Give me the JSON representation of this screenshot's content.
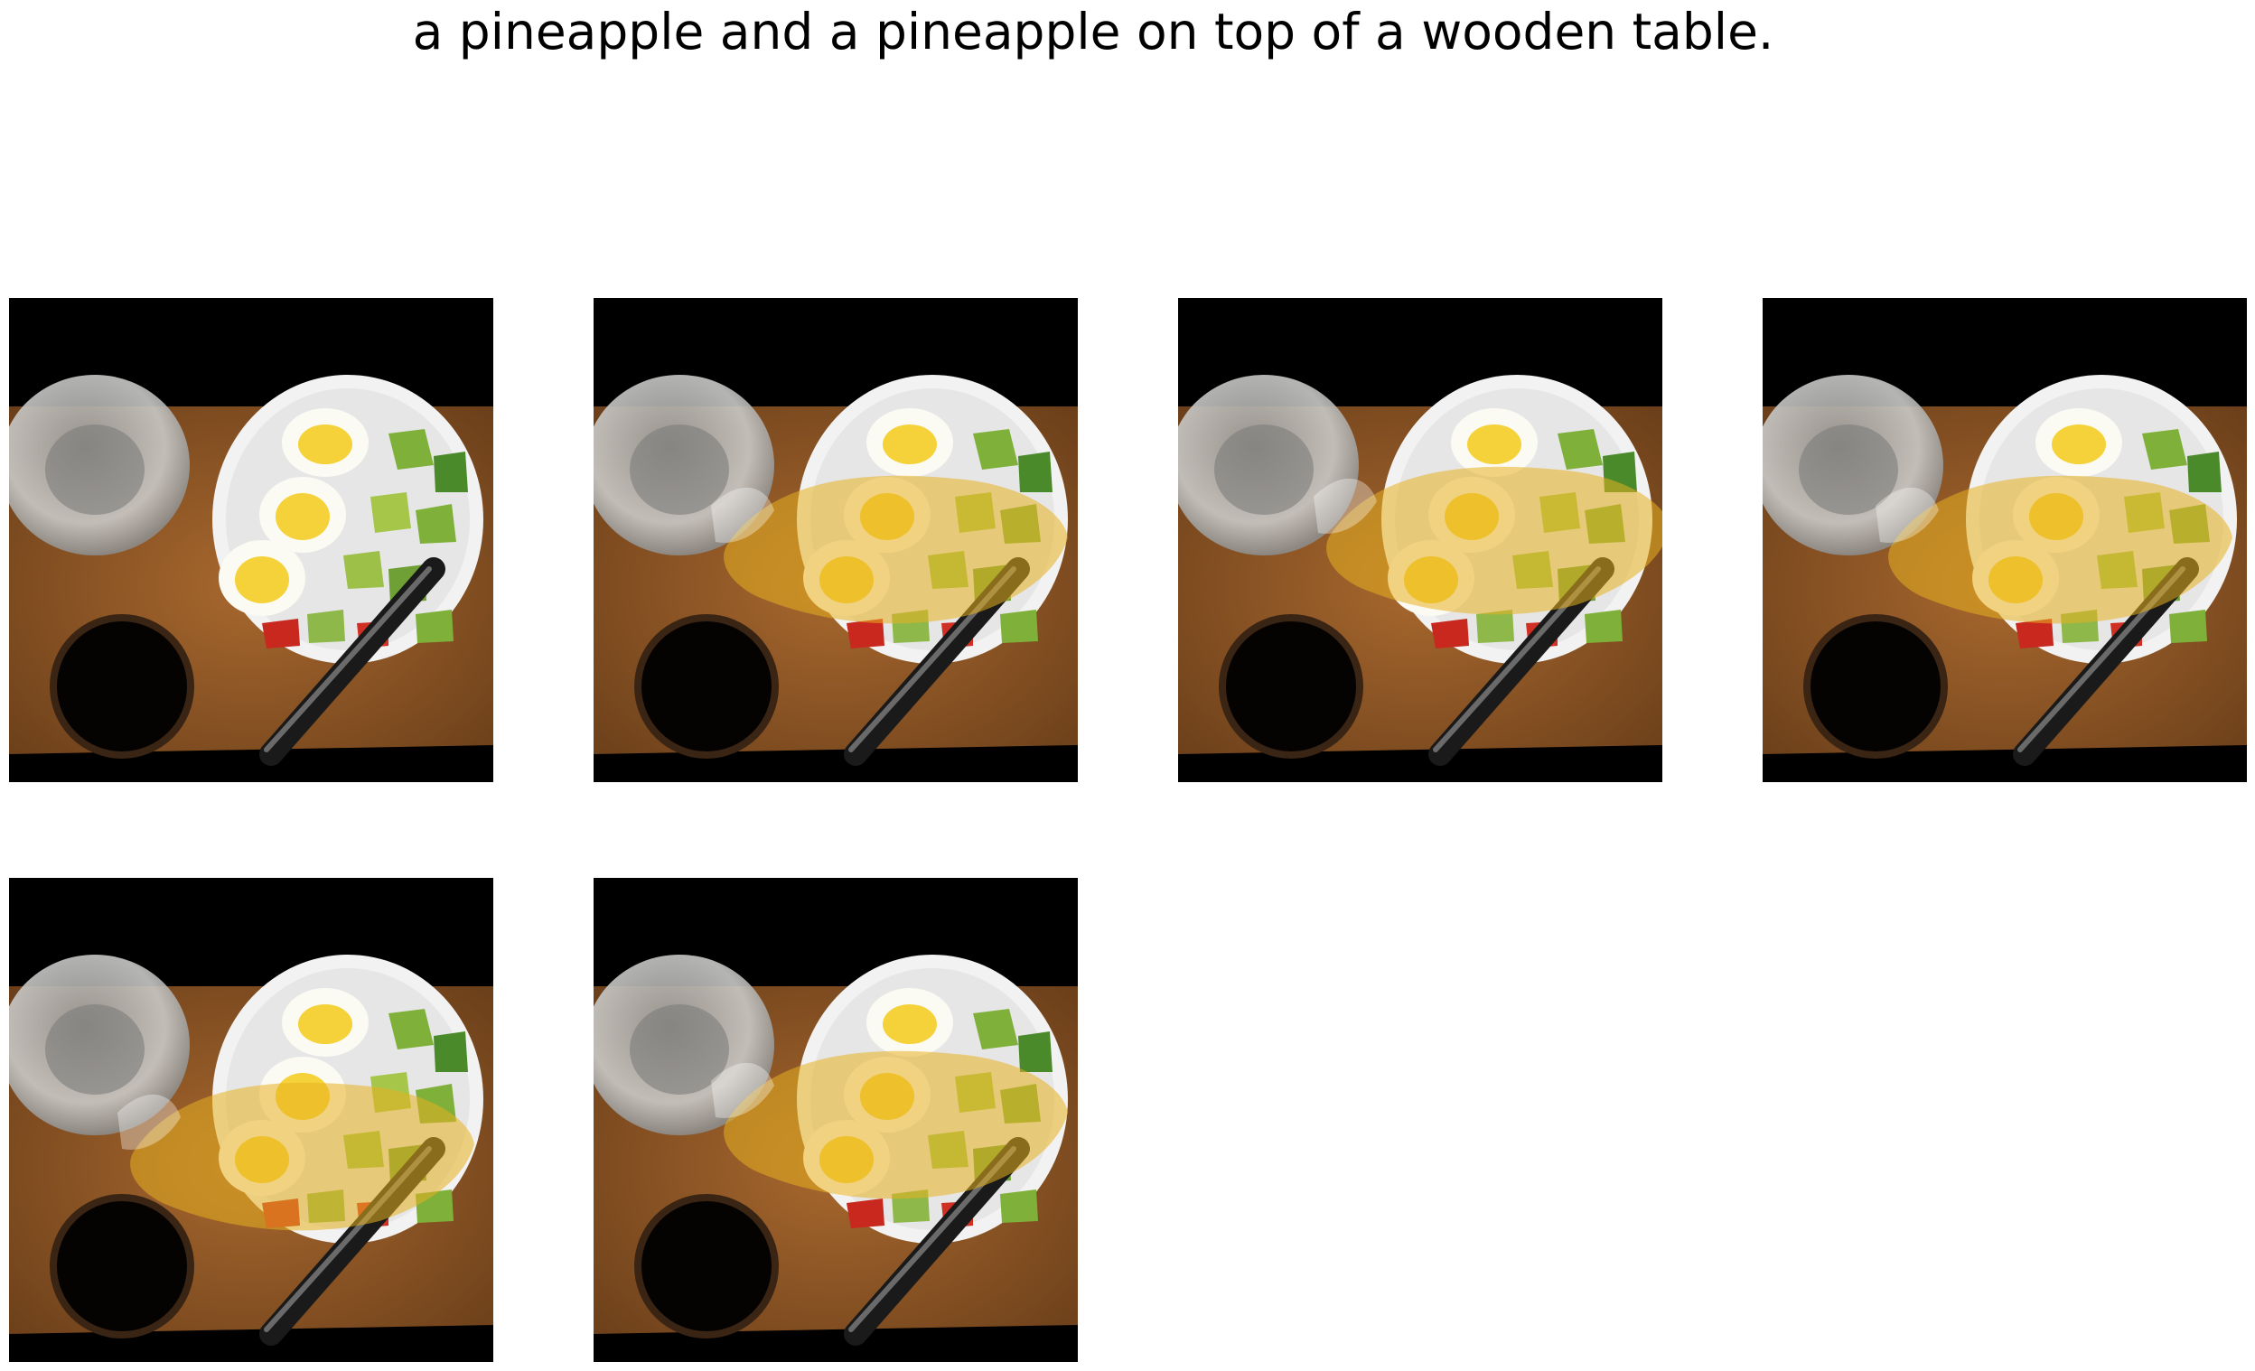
{
  "figure": {
    "title": "a pineapple and a pineapple on top of a wooden table."
  },
  "panels": [
    {
      "id": "p1",
      "overlay": false
    },
    {
      "id": "p2",
      "overlay": true
    },
    {
      "id": "p3",
      "overlay": true
    },
    {
      "id": "p4",
      "overlay": true
    },
    {
      "id": "p5",
      "overlay": true
    },
    {
      "id": "p6",
      "overlay": true
    }
  ],
  "colors": {
    "wood": "#8a5426",
    "bowl": "#f2f2f2",
    "egg_yolk": "#f5d23a",
    "avocado": "#7fb03a",
    "overlay": "#e8b020"
  }
}
